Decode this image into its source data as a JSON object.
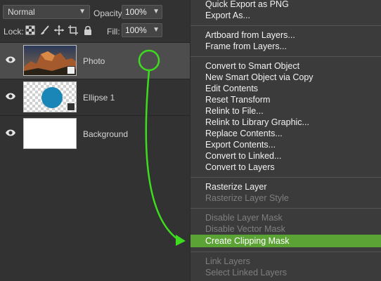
{
  "layers_panel": {
    "blend_mode": "Normal",
    "opacity_label": "Opacity:",
    "opacity_value": "100%",
    "lock_label": "Lock:",
    "fill_label": "Fill:",
    "fill_value": "100%",
    "layers": [
      {
        "name": "Photo",
        "selected": true,
        "thumbnail": "photo"
      },
      {
        "name": "Ellipse 1",
        "selected": false,
        "thumbnail": "ellipse"
      },
      {
        "name": "Background",
        "selected": false,
        "thumbnail": "white"
      }
    ]
  },
  "context_menu": {
    "items": [
      {
        "label": "Quick Export as PNG",
        "enabled": true
      },
      {
        "label": "Export As...",
        "enabled": true
      },
      {
        "label": "Artboard from Layers...",
        "enabled": true
      },
      {
        "label": "Frame from Layers...",
        "enabled": true
      },
      {
        "label": "Convert to Smart Object",
        "enabled": true
      },
      {
        "label": "New Smart Object via Copy",
        "enabled": true
      },
      {
        "label": "Edit Contents",
        "enabled": true
      },
      {
        "label": "Reset Transform",
        "enabled": true
      },
      {
        "label": "Relink to File...",
        "enabled": true
      },
      {
        "label": "Relink to Library Graphic...",
        "enabled": true
      },
      {
        "label": "Replace Contents...",
        "enabled": true
      },
      {
        "label": "Export Contents...",
        "enabled": true
      },
      {
        "label": "Convert to Linked...",
        "enabled": true
      },
      {
        "label": "Convert to Layers",
        "enabled": true
      },
      {
        "label": "Rasterize Layer",
        "enabled": true
      },
      {
        "label": "Rasterize Layer Style",
        "enabled": false
      },
      {
        "label": "Disable Layer Mask",
        "enabled": false
      },
      {
        "label": "Disable Vector Mask",
        "enabled": false
      },
      {
        "label": "Create Clipping Mask",
        "enabled": true,
        "highlighted": true
      },
      {
        "label": "Link Layers",
        "enabled": false
      },
      {
        "label": "Select Linked Layers",
        "enabled": false
      }
    ]
  },
  "colors": {
    "highlight": "#5ca335",
    "annotation": "#3ddc1e",
    "ellipse_fill": "#1a86b8"
  }
}
